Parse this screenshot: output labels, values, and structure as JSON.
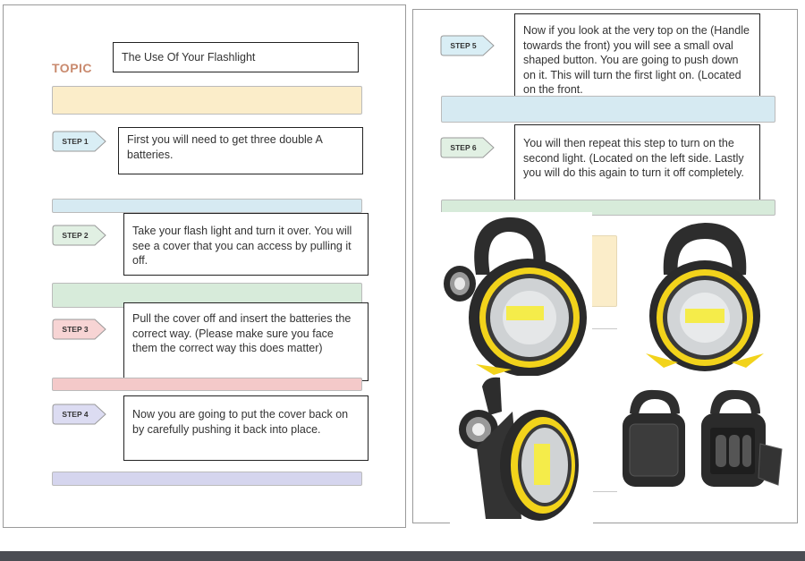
{
  "document": {
    "topic_label": "TOPIC",
    "topic_title": "The Use Of Your Flashlight",
    "steps": [
      {
        "label": "STEP 1",
        "text": "First you will need to get  three double A batteries.",
        "badge_color": "#d9eef5",
        "band_color": "#d6eaf2"
      },
      {
        "label": "STEP 2",
        "text": "Take your flash light and turn it over. You will see a cover that you can access by pulling it off.",
        "badge_color": "#e1f0e3",
        "band_color": "#d7ebda"
      },
      {
        "label": "STEP 3",
        "text": "Pull the cover off and insert the batteries the correct way. (Please make sure you face them the correct way this does matter)",
        "badge_color": "#f7d4d4",
        "band_color": "#f4c9c9"
      },
      {
        "label": "STEP 4",
        "text": "Now you are going to put the cover back on by carefully pushing it back into place.",
        "badge_color": "#dcdcf2",
        "band_color": "#d5d5ee"
      },
      {
        "label": "STEP 5",
        "text": "Now if you look at the very top on the (Handle towards the front) you will see a small oval shaped button. You are going to push down on it. This will turn the first light on. (Located on the front.",
        "badge_color": "#d9eef5",
        "band_color": "#d6eaf2"
      },
      {
        "label": "STEP 6",
        "text": "You will then repeat this step to turn on the second light. (Located on the left side. Lastly you will do this again to turn it off completely.",
        "badge_color": "#e1f0e3",
        "band_color": "#d7ebda"
      }
    ],
    "topic_band_color": "#fbedc9",
    "accent_colors": {
      "topic": "#c98a6e",
      "lamp_yellow": "#f2d31b",
      "body_dark": "#2b2b2b"
    },
    "images": [
      {
        "name": "flashlight-front-angle-photo"
      },
      {
        "name": "flashlight-front-photo"
      },
      {
        "name": "flashlight-side-photo"
      },
      {
        "name": "flashlight-back-battery-cover-photo"
      }
    ]
  }
}
